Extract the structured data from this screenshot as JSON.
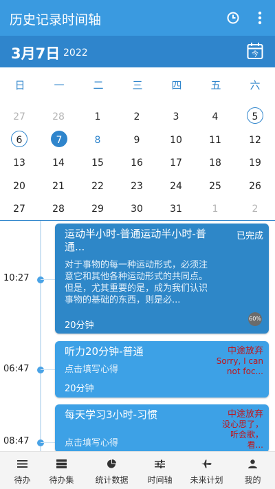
{
  "appbar": {
    "title": "历史记录时间轴"
  },
  "datebar": {
    "date": "3月7日",
    "year": "2022"
  },
  "calendar": {
    "weekdays": [
      "日",
      "一",
      "二",
      "三",
      "四",
      "五",
      "六"
    ],
    "rows": [
      [
        "27",
        "28",
        "1",
        "2",
        "3",
        "4",
        "5"
      ],
      [
        "6",
        "7",
        "8",
        "9",
        "10",
        "11",
        "12"
      ],
      [
        "13",
        "14",
        "15",
        "16",
        "17",
        "18",
        "19"
      ],
      [
        "20",
        "21",
        "22",
        "23",
        "24",
        "25",
        "26"
      ],
      [
        "27",
        "28",
        "29",
        "30",
        "31",
        "1",
        "2"
      ]
    ]
  },
  "timeline": {
    "entries": [
      {
        "time": "10:27",
        "title": "运动半小时-普通运动半小时-普通...",
        "status": "已完成",
        "desc": "对于事物的每一种运动形式，必须注意它和其他各种运动形式的共同点。但是，尤其重要的是，成为我们认识事物的基础的东西，则是必...",
        "duration": "20分钟",
        "progress": "60%"
      },
      {
        "time": "06:47",
        "title": "听力20分钟-普通",
        "status": "中途放弃",
        "status_note": "Sorry, I can not foc...",
        "desc": "点击填写心得",
        "duration": "20分钟"
      },
      {
        "time": "08:47",
        "title": "每天学习3小时-习惯",
        "status": "中途放弃",
        "status_note": "没心思了，听会歌，看...",
        "desc": "点击填写心得"
      }
    ]
  },
  "bottomnav": {
    "items": [
      "待办",
      "待办集",
      "统计数据",
      "时间轴",
      "未来计划",
      "我的"
    ]
  }
}
